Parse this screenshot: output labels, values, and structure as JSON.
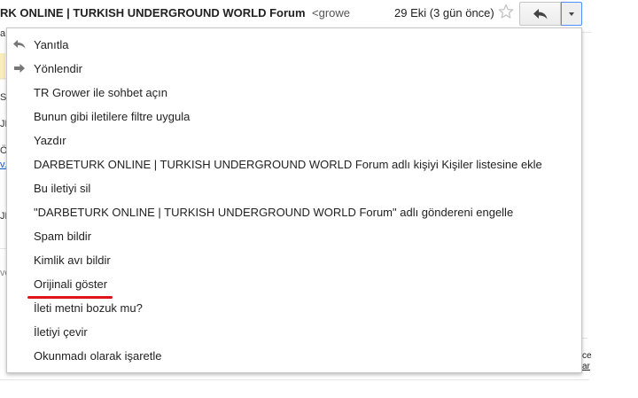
{
  "header": {
    "sender_name": "RK ONLINE | TURKISH UNDERGROUND WORLD Forum",
    "sender_email": "<growe",
    "date": "29 Eki (3 gün önce)",
    "star_icon": "star-outline-icon",
    "reply_icon": "reply-arrow-icon",
    "more_icon": "chevron-down-icon"
  },
  "background_fragments": {
    "left": [
      "a",
      "SL",
      "JF",
      "Öz",
      "v.c",
      "JF",
      "ve"
    ],
    "right": [
      "ce",
      "ar"
    ]
  },
  "menu": {
    "items": [
      {
        "label": "Yanıtla",
        "icon": "reply-icon"
      },
      {
        "label": "Yönlendir",
        "icon": "forward-icon"
      },
      {
        "label": "TR Grower ile sohbet açın"
      },
      {
        "label": "Bunun gibi iletilere filtre uygula"
      },
      {
        "label": "Yazdır"
      },
      {
        "label": "DARBETURK ONLINE | TURKISH UNDERGROUND WORLD Forum adlı kişiyi Kişiler listesine ekle"
      },
      {
        "label": "Bu iletiyi sil"
      },
      {
        "label": "\"DARBETURK ONLINE | TURKISH UNDERGROUND WORLD Forum\" adlı göndereni engelle"
      },
      {
        "label": "Spam bildir"
      },
      {
        "label": "Kimlik avı bildir"
      },
      {
        "label": "Orijinali göster"
      },
      {
        "label": "İleti metni bozuk mu?"
      },
      {
        "label": "İletiyi çevir"
      },
      {
        "label": "Okunmadı olarak işaretle"
      }
    ]
  },
  "colors": {
    "annotation_underline": "#e0121a",
    "focus_border": "#4d90fe"
  }
}
